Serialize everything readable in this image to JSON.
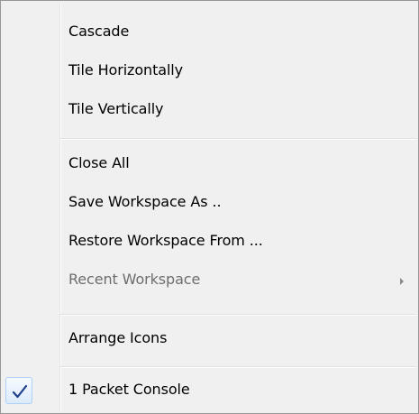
{
  "menu": {
    "items": [
      {
        "label": "Cascade"
      },
      {
        "label": "Tile Horizontally"
      },
      {
        "label": "Tile Vertically"
      },
      {
        "label": "Close All"
      },
      {
        "label": "Save Workspace As .."
      },
      {
        "label": "Restore Workspace From ..."
      },
      {
        "label": "Recent Workspace",
        "disabled": true,
        "has_submenu": true,
        "submenu_icon": "chevron-right-icon"
      },
      {
        "label": "Arrange Icons"
      },
      {
        "label": "1 Packet Console",
        "checked": true,
        "check_icon": "checkmark-icon"
      }
    ]
  },
  "colors": {
    "background": "#f0f0f0",
    "border": "#979797",
    "disabled_text": "#6d6d6d",
    "check": "#1e3f8a"
  }
}
